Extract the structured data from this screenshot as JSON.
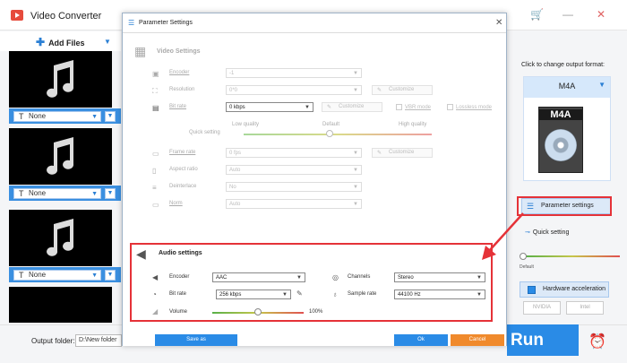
{
  "app": {
    "title": "Video Converter",
    "colors": {
      "accent": "#2a8be6",
      "highlight": "#e53238",
      "cancel": "#f08a2c"
    }
  },
  "toolbar": {
    "add_files": "Add Files"
  },
  "items": [
    {
      "subtitle": "None"
    },
    {
      "subtitle": "None"
    },
    {
      "subtitle": "None"
    }
  ],
  "bottom": {
    "output_label": "Output folder:",
    "output_value": "D:\\New folder",
    "run": "Run"
  },
  "right": {
    "click_label": "Click to change output format:",
    "format": "M4A",
    "file_label": "M4A",
    "param_btn": "Parameter settings",
    "quick_setting": "Quick setting",
    "default_label": "Default",
    "hw_accel": "Hardware acceleration",
    "nvidia": "NVIDIA",
    "intel": "Intel"
  },
  "dialog": {
    "title": "Parameter Settings",
    "video": {
      "heading": "Video Settings",
      "encoder_label": "Encoder",
      "encoder_value": "-1",
      "resolution_label": "Resolution",
      "resolution_value": "0*0",
      "customize": "Customize",
      "bitrate_label": "Bit rate",
      "bitrate_value": "0 kbps",
      "vbr_label": "VBR mode",
      "lossless_label": "Lossless mode",
      "quick_setting": "Quick setting",
      "low_quality": "Low quality",
      "default": "Default",
      "high_quality": "High quality",
      "framerate_label": "Frame rate",
      "framerate_value": "0 fps",
      "aspect_label": "Aspect ratio",
      "aspect_value": "Auto",
      "deinterlace_label": "Deinterlace",
      "deinterlace_value": "No",
      "norm_label": "Norm",
      "norm_value": "Auto"
    },
    "audio": {
      "heading": "Audio settings",
      "encoder_label": "Encoder",
      "encoder_value": "AAC",
      "channels_label": "Channels",
      "channels_value": "Stereo",
      "bitrate_label": "Bit rate",
      "bitrate_value": "256 kbps",
      "samplerate_label": "Sample rate",
      "samplerate_value": "44100 Hz",
      "volume_label": "Volume",
      "volume_value": "100%",
      "volume_level": 0.5
    },
    "buttons": {
      "save_as": "Save as",
      "ok": "Ok",
      "cancel": "Cancel"
    }
  }
}
